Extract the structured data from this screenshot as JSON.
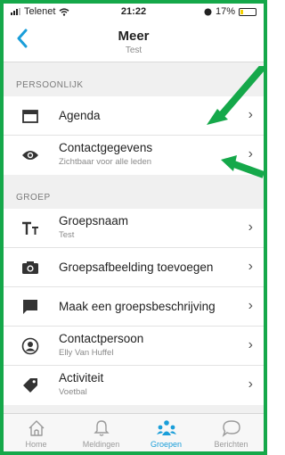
{
  "status_bar": {
    "carrier": "Telenet",
    "time": "21:22",
    "battery": "17%",
    "battery_level": 0.17
  },
  "header": {
    "back_icon": "chevron-left-icon",
    "title": "Meer",
    "subtitle": "Test"
  },
  "sections": {
    "persoonlijk": {
      "title": "PERSOONLIJK",
      "items": [
        {
          "label": "Agenda",
          "icon": "calendar-icon"
        },
        {
          "label": "Contactgegevens",
          "sub": "Zichtbaar voor alle leden",
          "icon": "eye-icon"
        }
      ]
    },
    "groep": {
      "title": "GROEP",
      "items": [
        {
          "label": "Groepsnaam",
          "sub": "Test",
          "icon": "text-icon"
        },
        {
          "label": "Groepsafbeelding toevoegen",
          "icon": "camera-icon"
        },
        {
          "label": "Maak een groepsbeschrijving",
          "icon": "chat-icon"
        },
        {
          "label": "Contactpersoon",
          "sub": "Elly Van Huffel",
          "icon": "person-icon"
        },
        {
          "label": "Activiteit",
          "sub": "Voetbal",
          "icon": "tag-icon"
        }
      ]
    }
  },
  "tabs": [
    {
      "label": "Home",
      "icon": "home-icon",
      "active": false
    },
    {
      "label": "Meldingen",
      "icon": "bell-icon",
      "active": false
    },
    {
      "label": "Groepen",
      "icon": "group-icon",
      "active": true
    },
    {
      "label": "Berichten",
      "icon": "message-icon",
      "active": false
    }
  ],
  "colors": {
    "accent": "#1a9ed9",
    "annotation_arrows": "#15a84a",
    "border_frame": "#15a84a"
  }
}
